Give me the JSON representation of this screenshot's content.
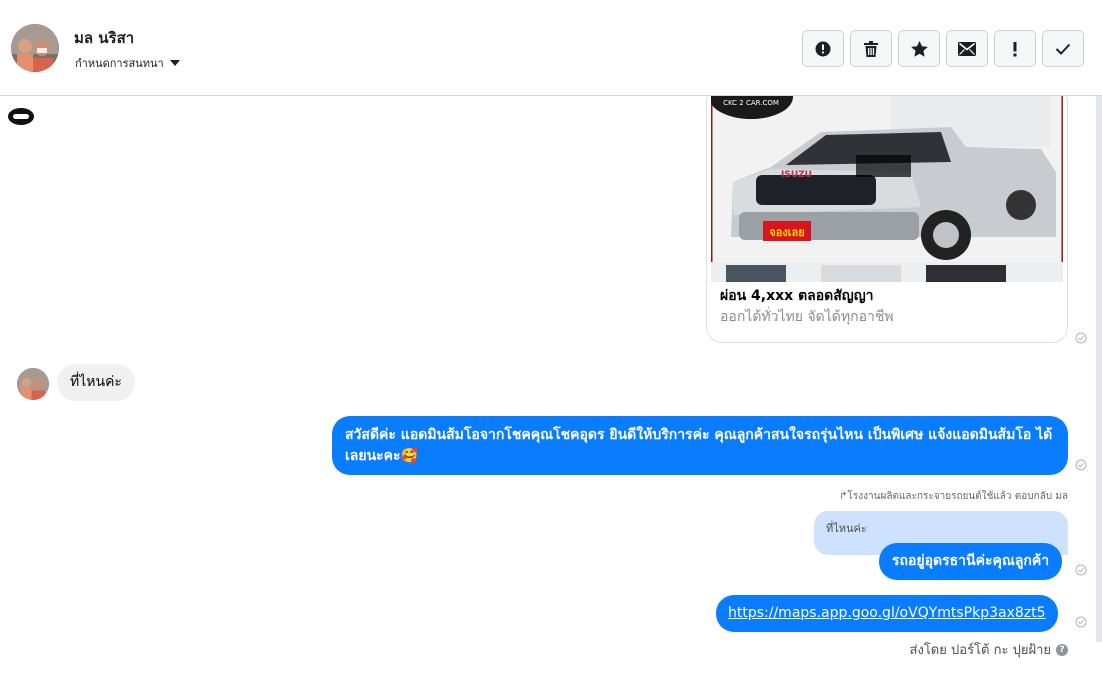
{
  "header": {
    "contact_name": "มล นริสา",
    "assign_label": "กำหนดการสนทนา",
    "toolbar": [
      {
        "name": "spam-button",
        "icon": "alert-circle-icon"
      },
      {
        "name": "delete-button",
        "icon": "trash-icon"
      },
      {
        "name": "star-button",
        "icon": "star-icon"
      },
      {
        "name": "mark-unread-button",
        "icon": "envelope-icon"
      },
      {
        "name": "follow-up-button",
        "icon": "exclamation-icon"
      },
      {
        "name": "mark-done-button",
        "icon": "checkmark-icon"
      }
    ]
  },
  "conversation": {
    "card": {
      "logo_text": "CKC 2 CAR.COM",
      "brand_text": "ISUZU",
      "badge_text": "จองเลย",
      "title": "ผ่อน 4,xxx ตลอดสัญญา",
      "subtitle": "ออกได้ทั่วไทย จัดได้ทุกอาชีพ"
    },
    "incoming": {
      "text": "ที่ไหนค่ะ"
    },
    "outgoing_1": {
      "text": "สวัสดีค่ะ แอดมินส้มโอจากโชคคุณโชคอุดร ยินดีให้บริการค่ะ   คุณลูกค้าสนใจรถรุ่นไหน เป็นพิเศษ แจ้งแอดมินส้มโอ ได้เลยนะคะ🥰"
    },
    "reply_note": "↱โรงงานผลิตและกระจายรถยนต์ใช้แล้ว ตอบกลับ มล",
    "quoted_text": "ที่ไหนค่ะ",
    "outgoing_2": {
      "text": "รถอยู่อุดรธานีค่ะคุณลูกค้า"
    },
    "outgoing_3": {
      "link": "https://maps.app.goo.gl/oVQYmtsPkp3ax8zt5"
    },
    "sent_by": "ส่งโดย ปอร์โต้ กะ ปุยฝ้าย",
    "help_icon": "?"
  },
  "colors": {
    "outgoing_bubble": "#0a7cff",
    "incoming_bubble": "#f0f0f0",
    "quote_bubble": "#cfe2fd"
  }
}
